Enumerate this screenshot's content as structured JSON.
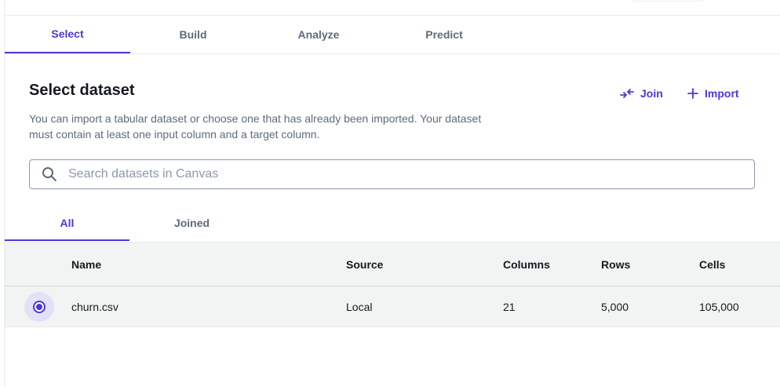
{
  "tabs": [
    {
      "label": "Select",
      "active": true
    },
    {
      "label": "Build",
      "active": false
    },
    {
      "label": "Analyze",
      "active": false
    },
    {
      "label": "Predict",
      "active": false
    }
  ],
  "section": {
    "title": "Select dataset",
    "description": "You can import a tabular dataset or choose one that has already been imported. Your dataset must contain at least one input column and a target column."
  },
  "actions": {
    "join": {
      "label": "Join",
      "icon": "join-icon"
    },
    "import": {
      "label": "Import",
      "icon": "plus-icon"
    }
  },
  "search": {
    "placeholder": "Search datasets in Canvas",
    "value": "",
    "icon": "search-icon"
  },
  "sub_tabs": [
    {
      "label": "All",
      "active": true
    },
    {
      "label": "Joined",
      "active": false
    }
  ],
  "table": {
    "columns": [
      "Name",
      "Source",
      "Columns",
      "Rows",
      "Cells"
    ],
    "rows": [
      {
        "selected": true,
        "name": "churn.csv",
        "source": "Local",
        "columns": "21",
        "rows": "5,000",
        "cells": "105,000"
      }
    ]
  },
  "colors": {
    "accent": "#4b39d6",
    "text": "#16191f",
    "muted": "#5f6b7a",
    "header_bg": "#f2f3f3"
  }
}
